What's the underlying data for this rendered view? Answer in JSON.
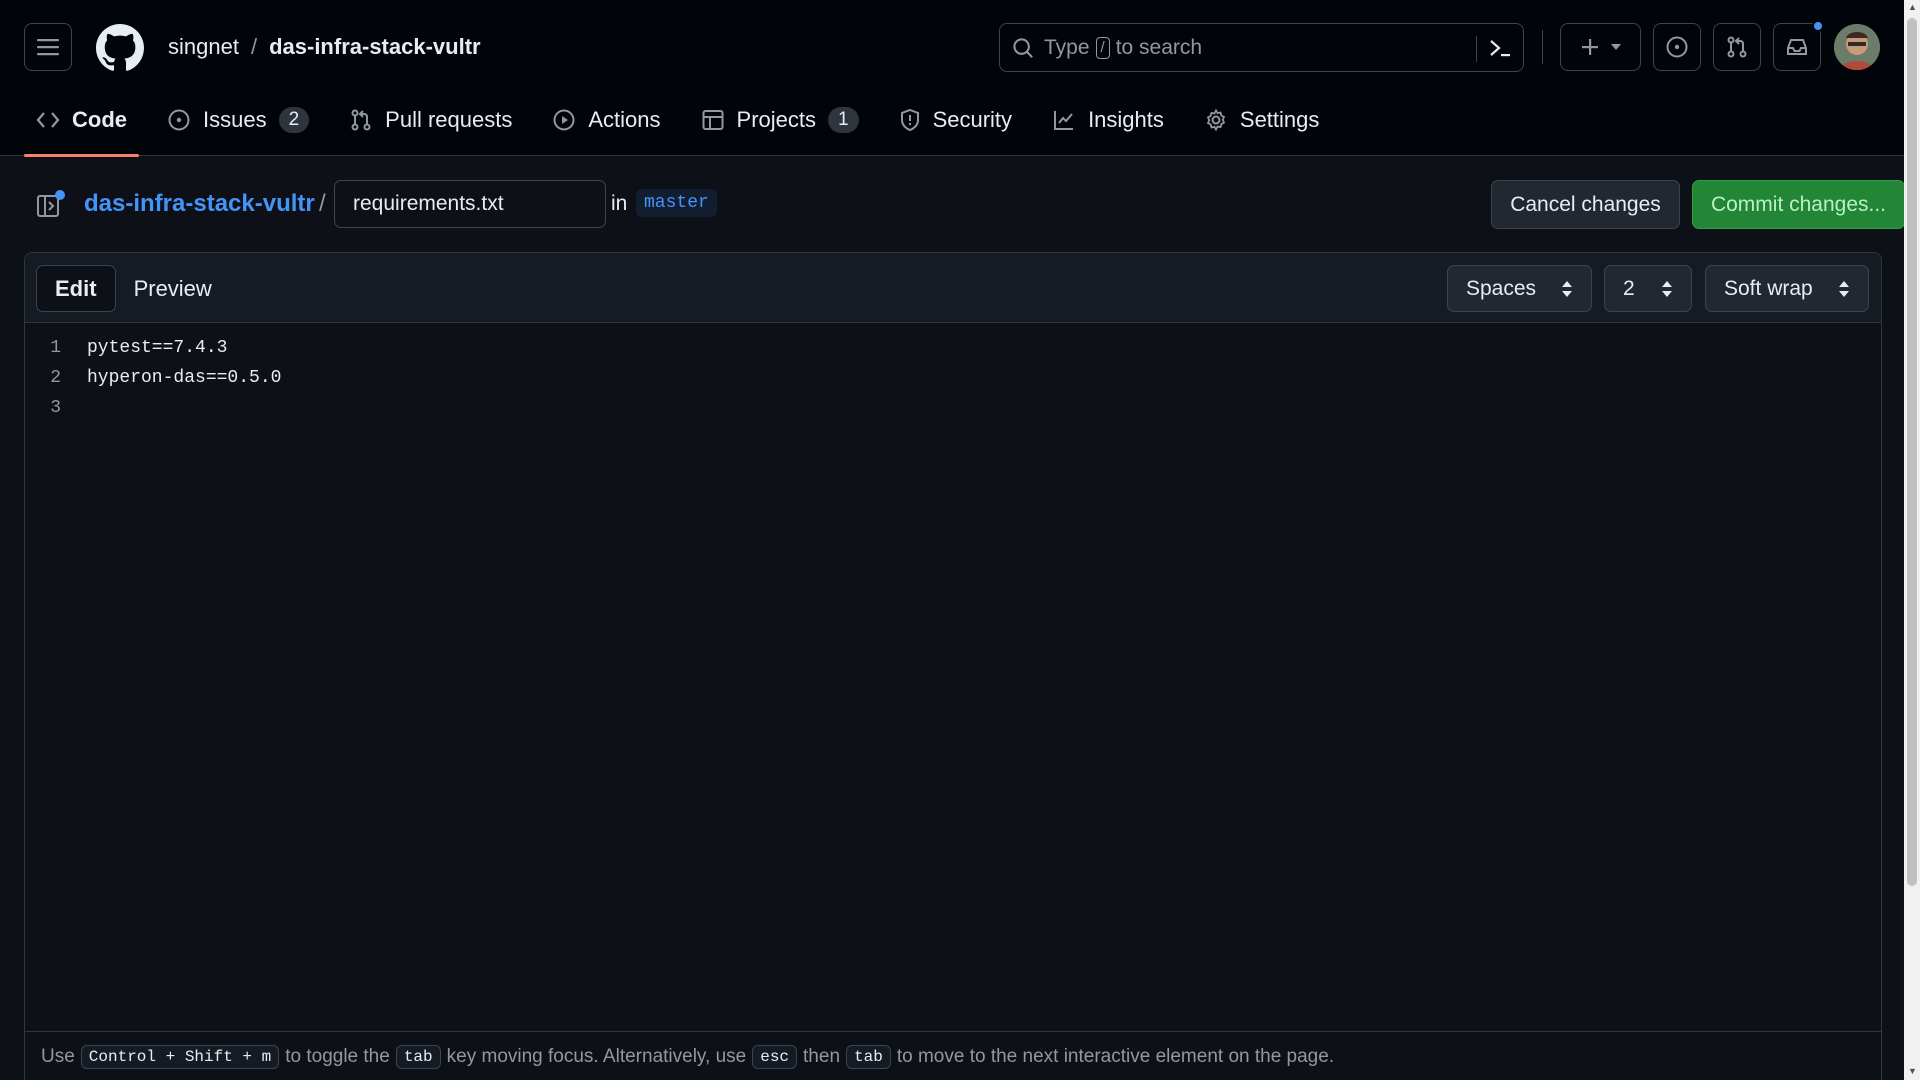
{
  "header": {
    "owner": "singnet",
    "separator": "/",
    "repo": "das-infra-stack-vultr",
    "search_prefix": "Type",
    "search_key": "/",
    "search_suffix": "to search"
  },
  "tabs": [
    {
      "label": "Code",
      "icon": "code-icon",
      "active": true
    },
    {
      "label": "Issues",
      "icon": "issue-opened-icon",
      "counter": "2"
    },
    {
      "label": "Pull requests",
      "icon": "git-pull-request-icon"
    },
    {
      "label": "Actions",
      "icon": "play-icon"
    },
    {
      "label": "Projects",
      "icon": "table-icon",
      "counter": "1"
    },
    {
      "label": "Security",
      "icon": "shield-icon"
    },
    {
      "label": "Insights",
      "icon": "graph-icon"
    },
    {
      "label": "Settings",
      "icon": "gear-icon"
    }
  ],
  "editor_header": {
    "repo_link": "das-infra-stack-vultr",
    "slash": "/",
    "filename": "requirements.txt",
    "in_label": "in",
    "branch": "master",
    "cancel_label": "Cancel changes",
    "commit_label": "Commit changes..."
  },
  "toolbar": {
    "edit_label": "Edit",
    "preview_label": "Preview",
    "indent_mode": "Spaces",
    "indent_size": "2",
    "wrap_mode": "Soft wrap"
  },
  "code": {
    "lines": [
      {
        "num": "1",
        "text": "pytest==7.4.3"
      },
      {
        "num": "2",
        "text": "hyperon-das==0.5.0"
      },
      {
        "num": "3",
        "text": ""
      }
    ]
  },
  "hint": {
    "use": "Use",
    "combo": "Control + Shift + m",
    "toggle": "to toggle the",
    "tab_key": "tab",
    "moving": "key moving focus. Alternatively, use",
    "esc_key": "esc",
    "then": "then",
    "tab_key2": "tab",
    "rest": "to move to the next interactive element on the page."
  },
  "colors": {
    "accent_blue": "#4493f8",
    "commit_green": "#238636",
    "tab_underline": "#f78166"
  }
}
